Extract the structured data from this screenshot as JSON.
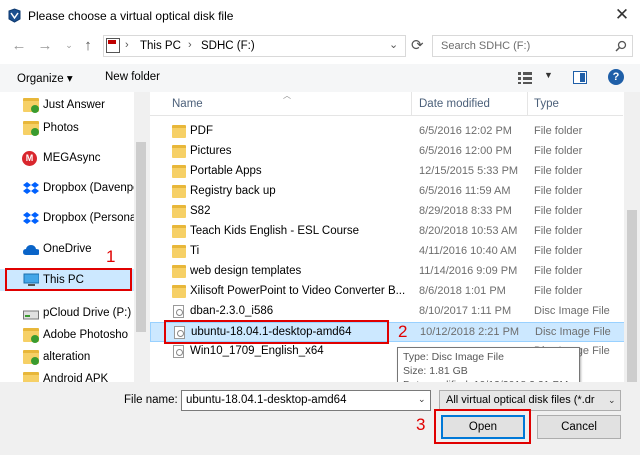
{
  "window": {
    "title": "Please choose a virtual optical disk file",
    "close_glyph": "✕"
  },
  "address": {
    "root": "This PC",
    "drive": "SDHC (F:)",
    "separator": "›"
  },
  "search": {
    "placeholder": "Search SDHC (F:)"
  },
  "toolbar": {
    "organize": "Organize",
    "new_folder": "New folder"
  },
  "nav_pane": {
    "items": [
      {
        "label": "Just Answer",
        "icon": "folder-check-icon"
      },
      {
        "label": "Photos",
        "icon": "folder-check-icon"
      },
      {
        "label": "MEGAsync",
        "icon": "mega-icon"
      },
      {
        "label": "Dropbox (Davenpo",
        "icon": "dropbox-icon"
      },
      {
        "label": "Dropbox (Persona",
        "icon": "dropbox-icon"
      },
      {
        "label": "OneDrive",
        "icon": "onedrive-icon"
      },
      {
        "label": "This PC",
        "icon": "computer-icon"
      },
      {
        "label": "pCloud Drive (P:)",
        "icon": "drive-icon"
      },
      {
        "label": "Adobe Photosho",
        "icon": "folder-check-icon"
      },
      {
        "label": "alteration",
        "icon": "folder-check-icon"
      },
      {
        "label": "Android APK",
        "icon": "folder-check-icon"
      }
    ]
  },
  "columns": {
    "name": "Name",
    "date": "Date modified",
    "type": "Type"
  },
  "files": [
    {
      "name": "PDF",
      "date": "6/5/2016 12:02 PM",
      "type": "File folder",
      "kind": "folder"
    },
    {
      "name": "Pictures",
      "date": "6/5/2016 12:00 PM",
      "type": "File folder",
      "kind": "folder"
    },
    {
      "name": "Portable Apps",
      "date": "12/15/2015 5:33 PM",
      "type": "File folder",
      "kind": "folder"
    },
    {
      "name": "Registry back up",
      "date": "6/5/2016 11:59 AM",
      "type": "File folder",
      "kind": "folder"
    },
    {
      "name": "S82",
      "date": "8/29/2018 8:33 PM",
      "type": "File folder",
      "kind": "folder"
    },
    {
      "name": "Teach Kids English - ESL Course",
      "date": "8/20/2018 10:53 AM",
      "type": "File folder",
      "kind": "folder"
    },
    {
      "name": "Ti",
      "date": "4/11/2016 10:40 AM",
      "type": "File folder",
      "kind": "folder"
    },
    {
      "name": "web design templates",
      "date": "11/14/2016 9:09 PM",
      "type": "File folder",
      "kind": "folder"
    },
    {
      "name": "Xilisoft PowerPoint to Video Converter B...",
      "date": "8/6/2018 1:01 PM",
      "type": "File folder",
      "kind": "folder"
    },
    {
      "name": "dban-2.3.0_i586",
      "date": "8/10/2017 1:11 PM",
      "type": "Disc Image File",
      "kind": "disc"
    },
    {
      "name": "ubuntu-18.04.1-desktop-amd64",
      "date": "10/12/2018 2:21 PM",
      "type": "Disc Image File",
      "kind": "disc"
    },
    {
      "name": "Win10_1709_English_x64",
      "date": "",
      "type": "Disc Image File",
      "kind": "disc"
    }
  ],
  "tooltip": {
    "type": "Type: Disc Image File",
    "size": "Size: 1.81 GB",
    "date": "Date modified: 10/12/2018 2:21 PM"
  },
  "bottom": {
    "file_name_label": "File name:",
    "file_name_value": "ubuntu-18.04.1-desktop-amd64",
    "file_type": "All virtual optical disk files (*.dr",
    "open": "Open",
    "cancel": "Cancel"
  },
  "annotations": {
    "step1": "1",
    "step2": "2",
    "step3": "3"
  },
  "colors": {
    "annotation": "#e00000",
    "selection": "#cce8ff"
  }
}
